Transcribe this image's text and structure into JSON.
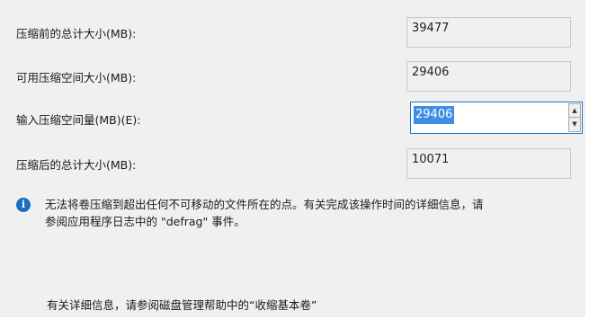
{
  "rows": {
    "total_before": {
      "label": "压缩前的总计大小(MB):",
      "value": "39477"
    },
    "available": {
      "label": "可用压缩空间大小(MB):",
      "value": "29406"
    },
    "input": {
      "label": "输入压缩空间量(MB)(E):",
      "value": "29406"
    },
    "total_after": {
      "label": "压缩后的总计大小(MB):",
      "value": "10071"
    }
  },
  "spin_up_icon": "triangle-up",
  "spin_down_icon": "triangle-down",
  "info": {
    "icon": "info-icon",
    "icon_glyph": "i",
    "icon_color": "#1b6ec2",
    "line1": "无法将卷压缩到超出任何不可移动的文件所在的点。有关完成该操作时间的详细信息，请",
    "line2": "参阅应用程序日志中的 \"defrag\" 事件。"
  },
  "help_text": "有关详细信息，请参阅磁盘管理帮助中的“收缩基本卷”",
  "colors": {
    "panel_bg": "#f0f0f0",
    "focus_border": "#1979ca",
    "selection": "#3d8ee4"
  }
}
